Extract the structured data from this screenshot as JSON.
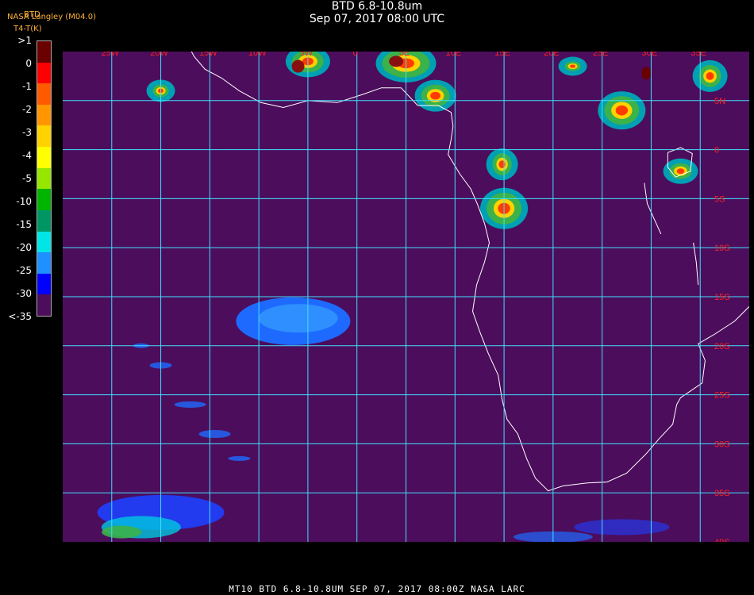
{
  "header": {
    "title": "BTD 6.8-10.8um",
    "subtitle": "Sep 07, 2017 08:00 UTC",
    "credit_line0": "BTD",
    "credit_line1": "NASA Langley (M04.0)",
    "credit_line2": "T4-T(K)"
  },
  "colorbar": {
    "labels": [
      ">1",
      "0",
      "-1",
      "-2",
      "-3",
      "-4",
      "-5",
      "-10",
      "-15",
      "-20",
      "-25",
      "-30",
      "<-35"
    ],
    "colors": [
      "#6b0000",
      "#ff0000",
      "#ff5a00",
      "#ff9600",
      "#ffd200",
      "#ffff00",
      "#96e600",
      "#00b400",
      "#009664",
      "#00e6e6",
      "#1e90ff",
      "#0000ff",
      "#4c0d5c"
    ]
  },
  "map": {
    "lon_labels": [
      "25W",
      "20W",
      "15W",
      "10W",
      "5W",
      "0",
      "5E",
      "10E",
      "15E",
      "20E",
      "25E",
      "30E",
      "35E"
    ],
    "lat_labels": [
      "5N",
      "0",
      "5S",
      "10S",
      "15S",
      "20S",
      "25S",
      "30S",
      "35S",
      "40S"
    ],
    "lon_range": [
      -30,
      40
    ],
    "lat_range": [
      -40,
      10
    ],
    "grid_color": "#40e0ff",
    "label_color": "#ff2020",
    "background_color": "#4c0d5c"
  },
  "footer": {
    "caption": "MT10   BTD 6.8-10.8UM   SEP 07, 2017 08:00Z   NASA LARC"
  }
}
